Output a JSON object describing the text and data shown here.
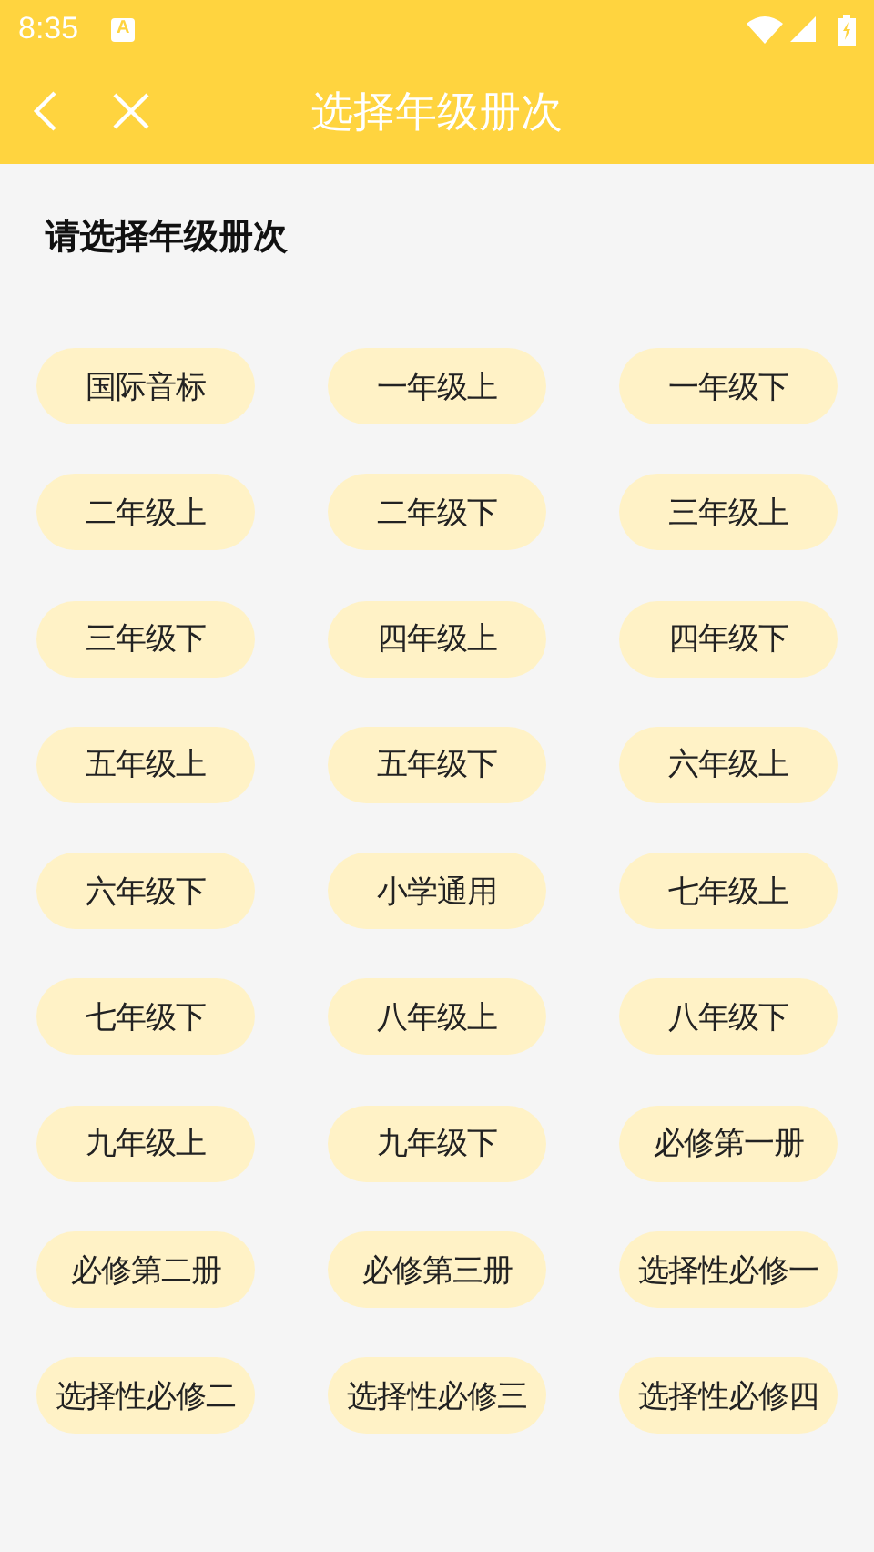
{
  "status_bar": {
    "time": "8:35",
    "notification": "A"
  },
  "app_bar": {
    "title": "选择年级册次"
  },
  "heading": "请选择年级册次",
  "grades": [
    {
      "label": "国际音标"
    },
    {
      "label": "一年级上"
    },
    {
      "label": "一年级下"
    },
    {
      "label": "二年级上"
    },
    {
      "label": "二年级下"
    },
    {
      "label": "三年级上"
    },
    {
      "label": "三年级下"
    },
    {
      "label": "四年级上"
    },
    {
      "label": "四年级下"
    },
    {
      "label": "五年级上"
    },
    {
      "label": "五年级下"
    },
    {
      "label": "六年级上"
    },
    {
      "label": "六年级下"
    },
    {
      "label": "小学通用"
    },
    {
      "label": "七年级上"
    },
    {
      "label": "七年级下"
    },
    {
      "label": "八年级上"
    },
    {
      "label": "八年级下"
    },
    {
      "label": "九年级上"
    },
    {
      "label": "九年级下"
    },
    {
      "label": "必修第一册"
    },
    {
      "label": "必修第二册"
    },
    {
      "label": "必修第三册"
    },
    {
      "label": "选择性必修一"
    },
    {
      "label": "选择性必修二"
    },
    {
      "label": "选择性必修三"
    },
    {
      "label": "选择性必修四"
    }
  ]
}
